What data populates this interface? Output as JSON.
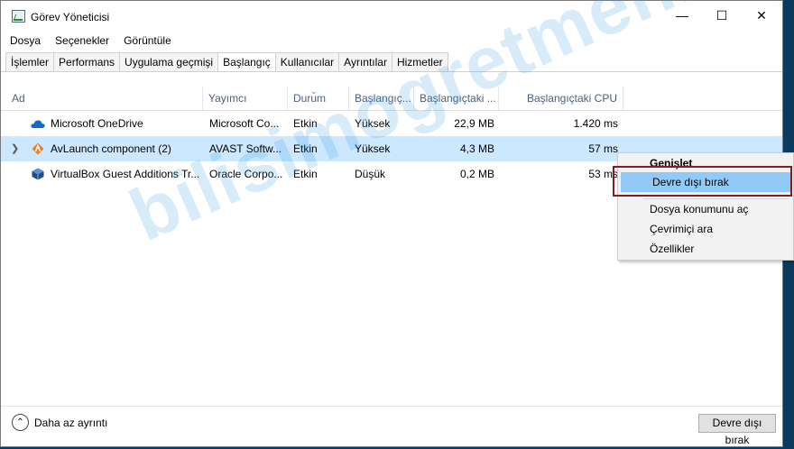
{
  "window": {
    "title": "Görev Yöneticisi"
  },
  "menu": [
    "Dosya",
    "Seçenekler",
    "Görüntüle"
  ],
  "tabs": [
    {
      "label": "İşlemler"
    },
    {
      "label": "Performans"
    },
    {
      "label": "Uygulama geçmişi"
    },
    {
      "label": "Başlangıç",
      "active": true
    },
    {
      "label": "Kullanıcılar"
    },
    {
      "label": "Ayrıntılar"
    },
    {
      "label": "Hizmetler"
    }
  ],
  "columns": [
    "Ad",
    "Yayımcı",
    "Durum",
    "Başlangıç...",
    "Başlangıçtaki ...",
    "Başlangıçtaki CPU"
  ],
  "rows": [
    {
      "name": "Microsoft OneDrive",
      "publisher": "Microsoft Co...",
      "status": "Etkin",
      "impact": "Yüksek",
      "disk": "22,9 MB",
      "cpu": "1.420 ms",
      "icon": "onedrive-icon"
    },
    {
      "name": "AvLaunch component (2)",
      "publisher": "AVAST Softw...",
      "status": "Etkin",
      "impact": "Yüksek",
      "disk": "4,3 MB",
      "cpu": "57 ms",
      "icon": "avast-icon",
      "selected": true,
      "expandable": true
    },
    {
      "name": "VirtualBox Guest Additions Tr...",
      "publisher": "Oracle Corpo...",
      "status": "Etkin",
      "impact": "Düşük",
      "disk": "0,2 MB",
      "cpu": "53 ms",
      "icon": "virtualbox-icon"
    }
  ],
  "context_menu": {
    "items": [
      "Genişlet",
      "Devre dışı bırak",
      "Dosya konumunu aç",
      "Çevrimiçi ara",
      "Özellikler"
    ]
  },
  "footer": {
    "more_details": "Daha az ayrıntı",
    "disable_button": "Devre dışı bırak"
  },
  "watermark": "bilisimogretmeni",
  "colors": {
    "selected_row": "#cce8ff",
    "menu_highlight": "#91c9f7",
    "header_text": "#4c607a",
    "annotation_box": "#8b1a1a"
  }
}
